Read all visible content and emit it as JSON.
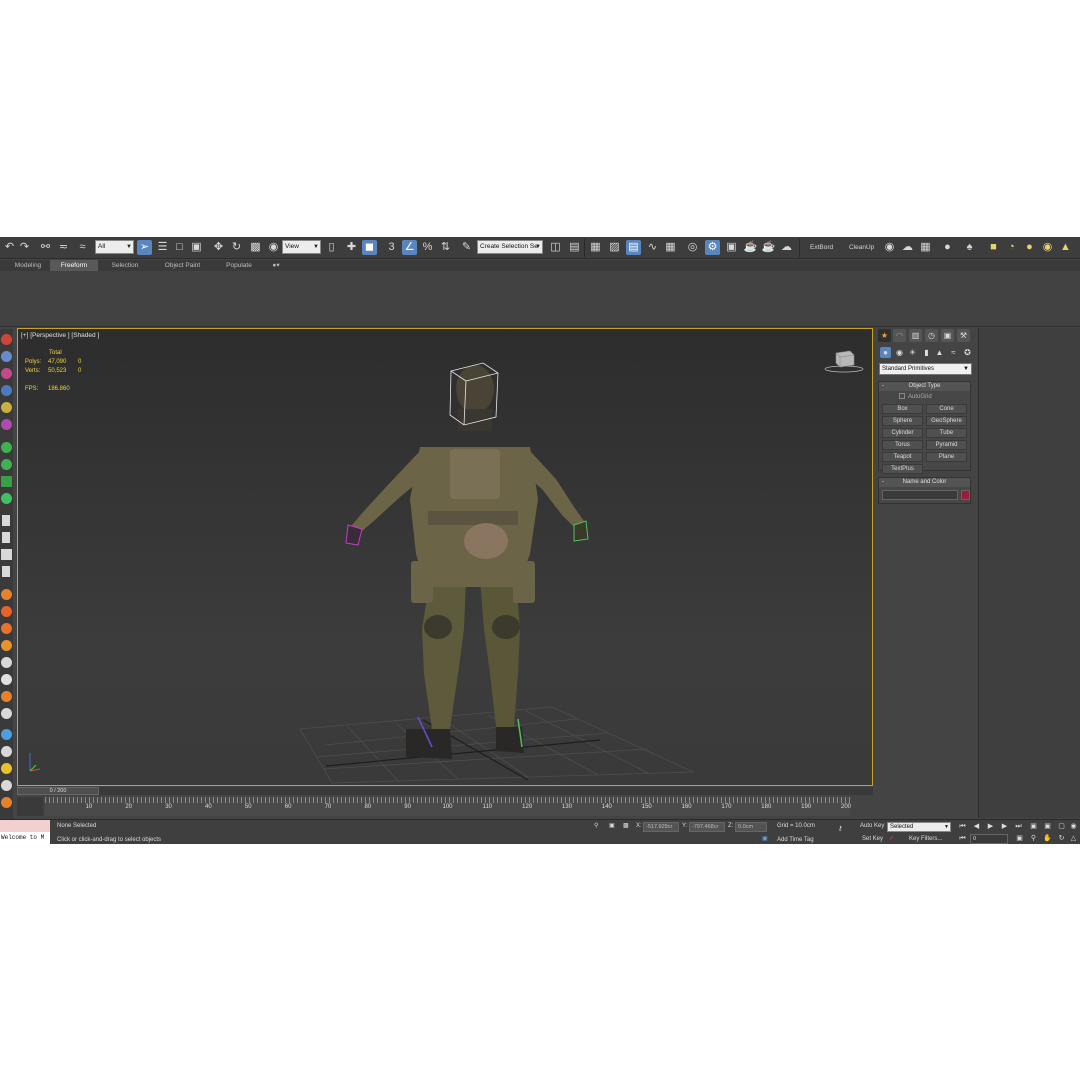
{
  "colors": {
    "viewport_border": "#c9a227",
    "stats_text": "#f2d53c",
    "active_blue": "#5a86c0",
    "name_color_swatch": "#a01a3e",
    "background": "#444444"
  },
  "toolbar": {
    "selection_filter": "All",
    "reference_coord": "View",
    "named_selection": "Create Selection Se",
    "extbord_label": "ExtBord",
    "cleanup_label": "CleanUp",
    "icons": [
      "undo-icon",
      "redo-icon",
      "link-icon",
      "unlink-icon",
      "bind-space-warp-icon",
      "select-object-icon",
      "select-by-name-icon",
      "rectangular-region-icon",
      "window-crossing-icon",
      "move-icon",
      "rotate-icon",
      "scale-icon",
      "pivot-icon",
      "snap-3d-icon",
      "angle-snap-icon",
      "percent-snap-icon",
      "spinner-snap-icon",
      "edit-named-selection-icon",
      "mirror-icon",
      "align-icon",
      "layer-icon",
      "scene-explorer-icon",
      "curve-editor-icon",
      "schematic-view-icon",
      "material-editor-icon",
      "render-setup-icon",
      "render-frame-icon",
      "render-icon",
      "teapot-render-icon"
    ]
  },
  "ribbon": {
    "tabs": [
      "Modeling",
      "Freeform",
      "Selection",
      "Object Paint",
      "Populate"
    ],
    "active_tab": "Freeform"
  },
  "viewport": {
    "label": "[+] [Perspective ] [Shaded ]",
    "stats": {
      "header": "Total",
      "polys_label": "Polys:",
      "polys_total": "47,090",
      "polys_sel": "0",
      "verts_label": "Verts:",
      "verts_total": "50,523",
      "verts_sel": "0",
      "fps_label": "FPS:",
      "fps_value": "186.860"
    }
  },
  "command_panel": {
    "tabs": [
      "create-tab",
      "modify-tab",
      "hierarchy-tab",
      "motion-tab",
      "display-tab",
      "utilities-tab"
    ],
    "category": "Standard Primitives",
    "object_type_header": "Object Type",
    "autogrid_label": "AutoGrid",
    "object_buttons": [
      "Box",
      "Cone",
      "Sphere",
      "GeoSphere",
      "Cylinder",
      "Tube",
      "Torus",
      "Pyramid",
      "Teapot",
      "Plane",
      "TextPlus"
    ],
    "name_color_header": "Name and Color",
    "name_value": ""
  },
  "timeline": {
    "frame_display": "0 / 200",
    "ticks": [
      "10",
      "20",
      "30",
      "40",
      "50",
      "60",
      "70",
      "80",
      "90",
      "100",
      "110",
      "120",
      "130",
      "140",
      "150",
      "160",
      "170",
      "180",
      "190",
      "200"
    ],
    "current_frame_fraction": 0
  },
  "status": {
    "maxscript": "Welcome to M",
    "selection": "None Selected",
    "prompt": "Click or click-and-drag to select objects",
    "x_label": "X:",
    "x_value": "-517.929cr",
    "y_label": "Y:",
    "y_value": "-797.468cr",
    "z_label": "Z:",
    "z_value": "0.0cm",
    "grid": "Grid = 10.0cm",
    "add_time_tag": "Add Time Tag",
    "auto_key": "Auto Key",
    "set_key": "Set Key",
    "key_mode": "Selected",
    "key_filters": "Key Filters...",
    "frame_field": "0"
  }
}
